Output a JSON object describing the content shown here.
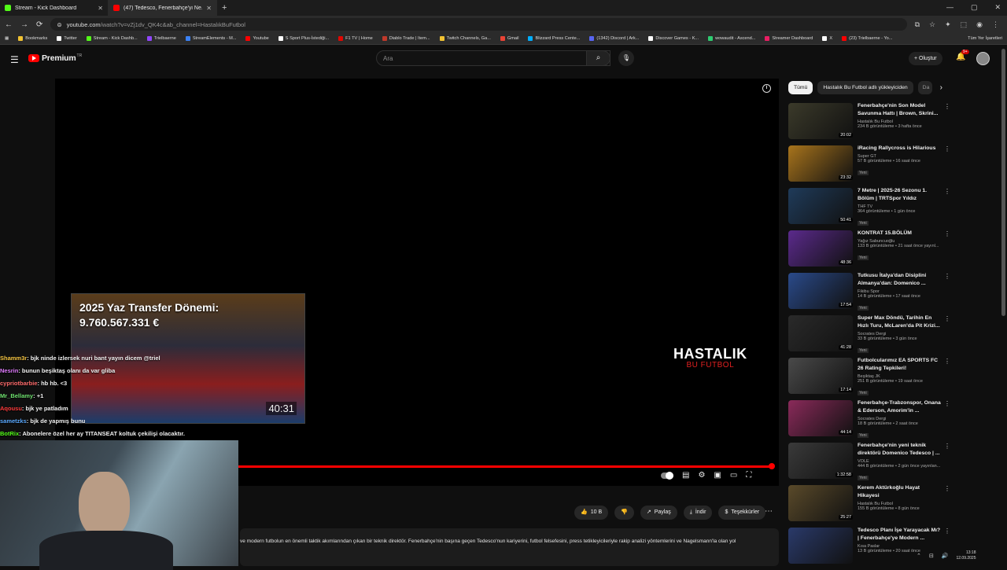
{
  "tabs": [
    {
      "title": "Stream - Kick Dashboard",
      "color": "#53fc18"
    },
    {
      "title": "(47) Tedesco, Fenerbahçe'yi Ne...",
      "color": "#ff0000"
    }
  ],
  "url": {
    "host": "youtube.com",
    "path": "/watch?v=vZj1dv_QK4c&ab_channel=HastalıkBuFutbol"
  },
  "bookmarks": [
    {
      "label": "Bookmarks",
      "color": "#f1c232"
    },
    {
      "label": "Twitter",
      "color": "#ffffff"
    },
    {
      "label": "Stream - Kick Dashb...",
      "color": "#53fc18"
    },
    {
      "label": "Trielbaerne",
      "color": "#9146ff"
    },
    {
      "label": "StreamElements - M...",
      "color": "#3b82f6"
    },
    {
      "label": "Youtube",
      "color": "#ff0000"
    },
    {
      "label": "S Sport Plus-İstediği...",
      "color": "#ffffff"
    },
    {
      "label": "F1 TV | Home",
      "color": "#e10600"
    },
    {
      "label": "Diablo Trade | Item...",
      "color": "#c0392b"
    },
    {
      "label": "Twitch Channels, Ga...",
      "color": "#f1c232"
    },
    {
      "label": "Gmail",
      "color": "#ea4335"
    },
    {
      "label": "Blizzard Press Cente...",
      "color": "#00aeff"
    },
    {
      "label": "(1342) Discord | Ark...",
      "color": "#5865f2"
    },
    {
      "label": "Discover Games - K...",
      "color": "#ffffff"
    },
    {
      "label": "wowaudit - Ascend...",
      "color": "#2ecc71"
    },
    {
      "label": "Streamer Dashboard",
      "color": "#e91e63"
    },
    {
      "label": "X",
      "color": "#ffffff"
    },
    {
      "label": "(23) Trielbaerne - Yo...",
      "color": "#ff0000"
    }
  ],
  "bookmarks_all": "Tüm Yer İşaretleri",
  "yt": {
    "logo": "Premium",
    "logo_sup": "TR",
    "search_placeholder": "Ara",
    "create": "Oluştur",
    "notif": "9+"
  },
  "overlay": {
    "title1": "2025 Yaz Transfer Dönemi:",
    "title2": "9.760.567.331 €",
    "duration": "40:31"
  },
  "watermark": {
    "line1": "HASTALIK",
    "line2": "BU FUTBOL"
  },
  "chat": [
    {
      "user": "Shamm3r",
      "msg": ": bjk ninde izlersek nuri bant yayın dicem @triel",
      "color": "#f5c542"
    },
    {
      "user": "Nesrin",
      "msg": ": bunun beşiktaş olanı da var gliba",
      "color": "#e07bff"
    },
    {
      "user": "cypriotbarbie",
      "msg": ": hb hb. <3",
      "color": "#ff6b6b"
    },
    {
      "user": "Mr_Bellamy",
      "msg": ": +1",
      "color": "#6ee06e"
    },
    {
      "user": "Aqousu",
      "msg": ": bjk ye patladım",
      "color": "#ff3b3b"
    },
    {
      "user": "sametzks",
      "msg": ": bjk de yapmış bunu",
      "color": "#5aa9ff"
    },
    {
      "user": "BotRix",
      "msg": ": Abonelere özel her ay TITANSEAT koltuk çekilişi olacaktır.",
      "color": "#53fc18"
    }
  ],
  "actions": {
    "likes": "10 B",
    "share": "Paylaş",
    "download": "İndir",
    "thanks": "Teşekkürler"
  },
  "description": "ve modern futbolun en önemli taktik akımlarından çıkan bir teknik direktör. Fenerbahçe'nin başına geçen Tedesco'nun kariyerini, futbol felsefesini, press tetikleyicileriyle rakip analizi yöntemlerini ve Nagelsmann'la olan yol",
  "chips": [
    "Tümü",
    "Hastalık Bu Futbol adlı yükleyiciden",
    "Da"
  ],
  "recommendations": [
    {
      "title": "Fenerbahçe'nin Son Model Savunma Hattı | Brown, Skrini...",
      "channel": "Hastalık Bu Futbol",
      "views": "234 B görüntüleme • 3 hafta önce",
      "duration": "20:02",
      "badge": "",
      "thumb": "#3b3a2a"
    },
    {
      "title": "iRacing Rallycross is Hilarious",
      "channel": "Super GT",
      "views": "57 B görüntüleme • 16 saat önce",
      "duration": "23:32",
      "badge": "Yeni",
      "thumb": "#a8741c"
    },
    {
      "title": "7 Metre | 2025-26 Sezonu 1. Bölüm | TRTSpor Yıldız",
      "channel": "THF TV",
      "views": "364 görüntüleme • 1 gün önce",
      "duration": "50:41",
      "badge": "Yeni",
      "thumb": "#1f3b5a"
    },
    {
      "title": "KONTRAT 15.BÖLÜM",
      "channel": "Yağız Sabuncuoğlu",
      "views": "133 B görüntüleme • 21 saat önce yayınl...",
      "duration": "48:36",
      "badge": "Yeni",
      "thumb": "#5b2a8c"
    },
    {
      "title": "Tutkusu İtalya'dan Disiplini Almanya'dan: Domenico ...",
      "channel": "Fikibu Spor",
      "views": "14 B görüntüleme • 17 saat önce",
      "duration": "17:54",
      "badge": "Yeni",
      "thumb": "#2a4a8a"
    },
    {
      "title": "Super Max Döndü, Tarihin En Hızlı Turu, McLaren'da Pit Krizi...",
      "channel": "Socrates Dergi",
      "views": "33 B görüntüleme • 3 gün önce",
      "duration": "41:28",
      "badge": "Yeni",
      "thumb": "#2a2a2a"
    },
    {
      "title": "Futbolcularımız EA SPORTS FC 26 Rating Tepkileri!",
      "channel": "Beşiktaş JK",
      "views": "251 B görüntüleme • 19 saat önce",
      "duration": "17:14",
      "badge": "Yeni",
      "thumb": "#4a4a4a"
    },
    {
      "title": "Fenerbahçe-Trabzonspor, Onana & Ederson, Amorim'in ...",
      "channel": "Socrates Dergi",
      "views": "18 B görüntüleme • 2 saat önce",
      "duration": "44:14",
      "badge": "Yeni",
      "thumb": "#8a2a5a"
    },
    {
      "title": "Fenerbahçe'nin yeni teknik direktörü Domenico Tedesco | ...",
      "channel": "VOLE",
      "views": "444 B görüntüleme • 2 gün önce yayınlan...",
      "duration": "1:32:58",
      "badge": "Yeni",
      "thumb": "#3a3a3a"
    },
    {
      "title": "Kerem Aktürkoğlu Hayat Hikayesi",
      "channel": "Hastalık Bu Futbol",
      "views": "155 B görüntüleme • 8 gün önce",
      "duration": "25:27",
      "badge": "",
      "thumb": "#5a4a2a"
    },
    {
      "title": "Tedesco Planı İşe Yarayacak Mı? | Fenerbahçe'ye Modern ...",
      "channel": "Kısa Paslar",
      "views": "13 B görüntüleme • 20 saat önce",
      "duration": "",
      "badge": "",
      "thumb": "#2a3a6a"
    }
  ],
  "clock": {
    "time": "13:18",
    "date": "12.09.2025"
  }
}
